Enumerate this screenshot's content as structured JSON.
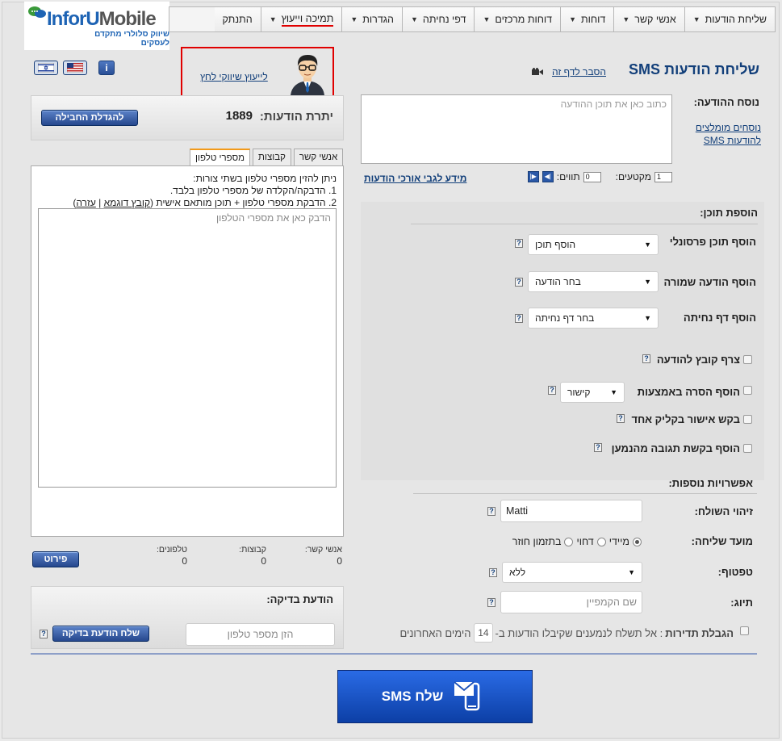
{
  "nav": {
    "items": [
      {
        "label": "שליחת הודעות",
        "arrow": true
      },
      {
        "label": "אנשי קשר",
        "arrow": true
      },
      {
        "label": "דוחות",
        "arrow": true
      },
      {
        "label": "דוחות מרכזים",
        "arrow": true
      },
      {
        "label": "דפי נחיתה",
        "arrow": true
      },
      {
        "label": "הגדרות",
        "arrow": true
      },
      {
        "label": "תמיכה וייעוץ",
        "arrow": true,
        "active": true
      },
      {
        "label": "התנתק",
        "arrow": false
      }
    ]
  },
  "logo": {
    "part1": "Infor",
    "part2": "U",
    "part3": "Mobile",
    "tagline": "שיווק סלולרי מתקדם לעסקים"
  },
  "consult": {
    "link": "לייעוץ שיווקי לחץ"
  },
  "page": {
    "title": "שליחת הודעות SMS",
    "help_link": "הסבר לדף זה"
  },
  "message": {
    "label": "נוסח ההודעה:",
    "placeholder": "כתוב כאן את תוכן ההודעה",
    "recommended_link": "נוסחים מומלצים להודעות SMS",
    "chars_label": "תווים:",
    "chars_value": "0",
    "segments_label": "מקטעים:",
    "segments_value": "1",
    "long_msg_link": "מידע לגבי אורכי הודעות"
  },
  "content": {
    "title": "הוספת תוכן:",
    "personal": {
      "label": "הוסף תוכן פרסונלי",
      "value": "הוסף תוכן"
    },
    "saved": {
      "label": "הוסף הודעה שמורה",
      "value": "בחר הודעה"
    },
    "landing": {
      "label": "הוסף דף נחיתה",
      "value": "בחר דף נחיתה"
    },
    "attach": "צרף קובץ להודעה",
    "unsub": {
      "label": "הוסף הסרה באמצעות",
      "value": "קישור"
    },
    "confirm": "בקש אישור בקליק אחד",
    "reply": "הוסף בקשת תגובה מהנמען"
  },
  "more": {
    "title": "אפשרויות נוספות:",
    "sender": {
      "label": "זיהוי השולח:",
      "value": "Matti"
    },
    "timing": {
      "label": "מועד שליחה:",
      "opt1": "מיידי",
      "opt2": "דחוי",
      "opt3": "בתזמון חוזר"
    },
    "throttle": {
      "label": "טפטוף:",
      "value": "ללא"
    },
    "tag": {
      "label": "תיוג:",
      "placeholder": "שם הקמפיין"
    },
    "freq": {
      "label": "הגבלת תדירות",
      "text": ": אל תשלח לנמענים שקיבלו הודעות ב-",
      "days": "14",
      "suffix": "הימים האחרונים"
    }
  },
  "credits": {
    "label": "יתרת הודעות:",
    "value": "1889",
    "button": "להגדלת החבילה"
  },
  "tabs": [
    {
      "label": "אנשי קשר"
    },
    {
      "label": "קבוצות"
    },
    {
      "label": "מספרי טלפון",
      "active": true
    }
  ],
  "phones": {
    "line1": "ניתן להזין מספרי טלפון בשתי צורות:",
    "line2": "1. הדבקה/הקלדה של מספרי טלפון בלבד.",
    "line3": "2. הדבקת מספרי טלפון + תוכן מותאם אישית (",
    "sample_link": "קובץ דוגמא",
    "sep": " | ",
    "help_link": "עזרה",
    "close": ")",
    "placeholder": "הדבק כאן את מספרי הטלפון"
  },
  "stats": {
    "contacts_label": "אנשי קשר:",
    "contacts_value": "0",
    "groups_label": "קבוצות:",
    "groups_value": "0",
    "phones_label": "טלפונים:",
    "phones_value": "0",
    "details_button": "פירוט"
  },
  "test": {
    "title": "הודעת בדיקה:",
    "button": "שלח הודעת בדיקה",
    "placeholder": "הזן מספר טלפון"
  },
  "send": {
    "label": "שלח SMS"
  },
  "help_glyph": "?"
}
